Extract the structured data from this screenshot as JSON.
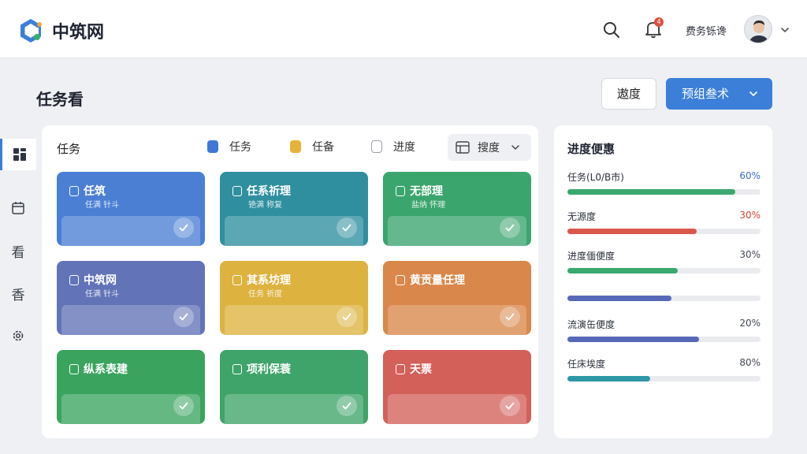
{
  "brand": {
    "name": "中筑网"
  },
  "topbar": {
    "user_name": "费务铄谗",
    "bell_badge": "4"
  },
  "page": {
    "title": "任务看",
    "secondary_button": "遨度",
    "primary_button": "预组叁术"
  },
  "rail": {
    "items": [
      "",
      "",
      "看",
      "香",
      ""
    ]
  },
  "board": {
    "title": "任务",
    "legend": [
      {
        "label": "任务",
        "color": "#3f78d6"
      },
      {
        "label": "任备",
        "color": "#e6b33a"
      },
      {
        "label": "进度",
        "color": "#9aa0aa"
      }
    ],
    "view_select": "搜度",
    "cards": [
      {
        "title": "任筑",
        "subtitle": "任满 针斗",
        "color": "#4a7fd4"
      },
      {
        "title": "任系祈理",
        "subtitle": "铯满 称复",
        "color": "#2f8f9f"
      },
      {
        "title": "无部理",
        "subtitle": "盐纳 怀理",
        "color": "#3aa56d"
      },
      {
        "title": "中筑网",
        "subtitle": "任满 针斗",
        "color": "#6273b8"
      },
      {
        "title": "其系坊理",
        "subtitle": "任务 祈度",
        "color": "#ddb23f"
      },
      {
        "title": "黄贡量任理",
        "subtitle": "",
        "color": "#d9874a"
      },
      {
        "title": "纵系表建",
        "subtitle": "",
        "color": "#3aa45f"
      },
      {
        "title": "项利保蓑",
        "subtitle": "",
        "color": "#3ea46a"
      },
      {
        "title": "天票",
        "subtitle": "",
        "color": "#d4605a"
      }
    ]
  },
  "progress": {
    "title": "进度便惠",
    "rows": [
      {
        "label": "任务(L0/B市)",
        "value": "60%",
        "value_color": "#3c6fc6",
        "fill": 0.87,
        "color": "#3aa86f"
      },
      {
        "label": "无源度",
        "value": "30%",
        "value_color": "#d0463c",
        "fill": 0.67,
        "color": "#d9584e"
      },
      {
        "label": "进度偭便度",
        "value": "30%",
        "value_color": "#444a55",
        "fill": 0.57,
        "color": "#3aa86f"
      },
      {
        "label": "",
        "value": "",
        "value_color": "#444a55",
        "fill": 0.54,
        "color": "#5868b8"
      },
      {
        "label": "流演缶便度",
        "value": "20%",
        "value_color": "#444a55",
        "fill": 0.68,
        "color": "#5868b8"
      },
      {
        "label": "任床埃度",
        "value": "80%",
        "value_color": "#444a55",
        "fill": 0.43,
        "color": "#2f97a5"
      }
    ]
  }
}
